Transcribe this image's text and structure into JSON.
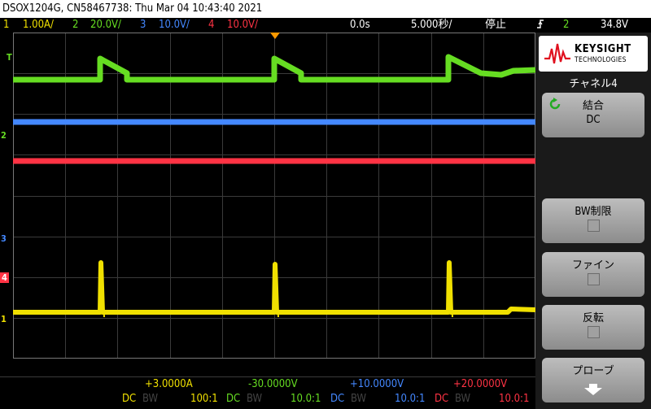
{
  "title": "DSOX1204G, CN58467738: Thu Mar 04 10:43:40 2021",
  "topbar": {
    "ch1": {
      "num": "1",
      "scale": "1.00A/",
      "color": "#f0e000"
    },
    "ch2": {
      "num": "2",
      "scale": "20.0V/",
      "color": "#66dd22"
    },
    "ch3": {
      "num": "3",
      "scale": "10.0V/",
      "color": "#4488ff"
    },
    "ch4": {
      "num": "4",
      "scale": "10.0V/",
      "color": "#ff3344"
    },
    "time_position": "0.0s",
    "time_scale": "5.000秒/",
    "run_state": "停止",
    "trigger_channel": "2",
    "trigger_level": "34.8V"
  },
  "brand": {
    "name": "KEYSIGHT",
    "sub": "TECHNOLOGIES"
  },
  "menu": {
    "title": "チャネル4",
    "softkeys": [
      {
        "label": "結合",
        "value": "DC",
        "icon": "refresh-icon"
      },
      {
        "label": "BW制限",
        "checked": false
      },
      {
        "label": "ファイン",
        "checked": false
      },
      {
        "label": "反転",
        "checked": false
      },
      {
        "label": "プローブ",
        "icon": "down-arrow-icon"
      }
    ]
  },
  "channel_markers": {
    "trigger": "T",
    "ch1": "1",
    "ch2": "2",
    "ch3": "3",
    "ch4": "4"
  },
  "bottom": {
    "offsets": [
      {
        "text": "+3.0000A",
        "color": "#f0e000"
      },
      {
        "text": "-30.0000V",
        "color": "#66dd22"
      },
      {
        "text": "+10.0000V",
        "color": "#4488ff"
      },
      {
        "text": "+20.0000V",
        "color": "#ff3344"
      }
    ],
    "details": [
      {
        "coupling": "DC",
        "bw": "BW",
        "probe": "100:1",
        "color": "#f0e000"
      },
      {
        "coupling": "DC",
        "bw": "BW",
        "probe": "10.0:1",
        "color": "#66dd22"
      },
      {
        "coupling": "DC",
        "bw": "BW",
        "probe": "10.0:1",
        "color": "#4488ff"
      },
      {
        "coupling": "DC",
        "bw": "BW",
        "probe": "10.0:1",
        "color": "#ff3344"
      }
    ]
  }
}
